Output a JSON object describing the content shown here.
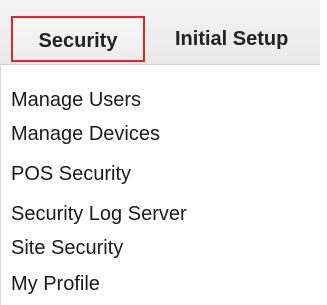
{
  "tabs": [
    {
      "label": "Security",
      "active": true
    },
    {
      "label": "Initial Setup",
      "active": false
    }
  ],
  "menu": {
    "items": [
      {
        "label": "Manage Users"
      },
      {
        "label": "Manage Devices"
      },
      {
        "label": "POS Security"
      },
      {
        "label": "Security Log Server"
      },
      {
        "label": "Site Security"
      },
      {
        "label": "My Profile"
      }
    ]
  },
  "colors": {
    "active_tab_border": "#e0252b",
    "text": "#1a1a1a",
    "tabbar_background": "#eeeeee"
  }
}
